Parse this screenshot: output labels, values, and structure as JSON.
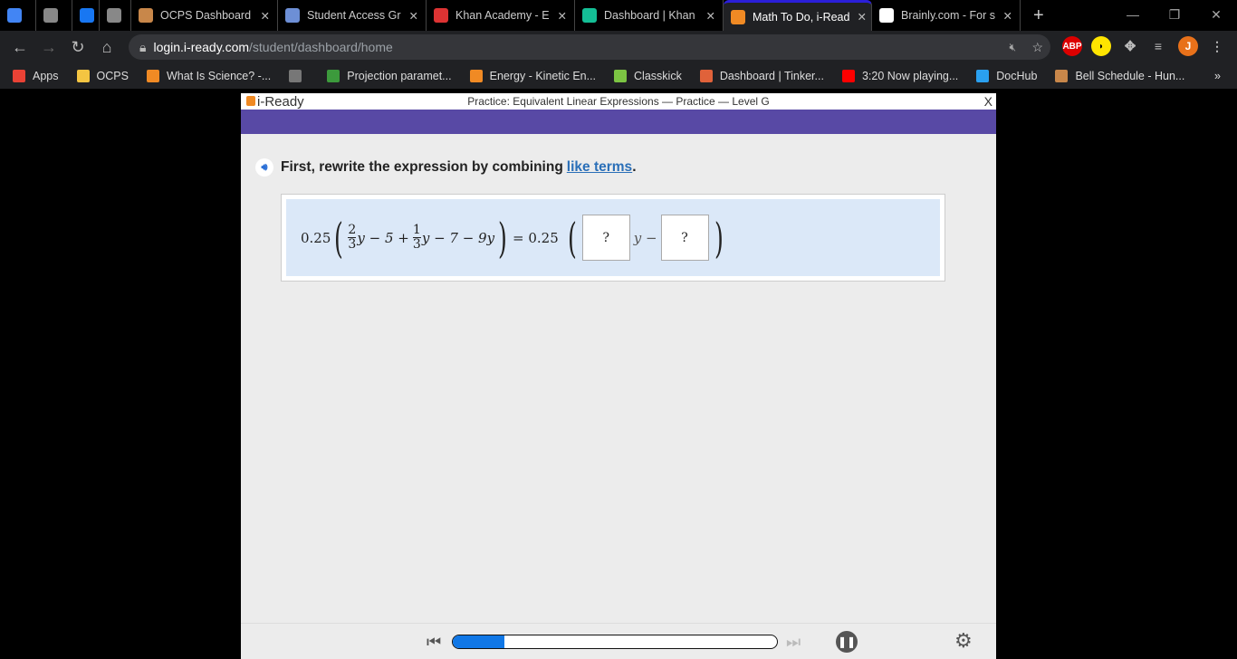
{
  "tabs": [
    {
      "label": "",
      "icon": "docs-icon",
      "color": "#4285f4"
    },
    {
      "label": "",
      "icon": "muted-audio-icon",
      "color": "#888"
    },
    {
      "label": "",
      "icon": "facebook-icon",
      "color": "#1877f2"
    },
    {
      "label": "",
      "icon": "muted-audio-icon",
      "color": "#888"
    },
    {
      "label": "OCPS Dashboard",
      "icon": "ocps-icon",
      "color": "#c8874a"
    },
    {
      "label": "Student Access Gr",
      "icon": "student-access-icon",
      "color": "#6d8fd6"
    },
    {
      "label": "Khan Academy - E",
      "icon": "khan-loading-icon",
      "color": "#d33"
    },
    {
      "label": "Dashboard | Khan",
      "icon": "khan-icon",
      "color": "#14bf96"
    },
    {
      "label": "Math To Do, i-Read",
      "icon": "iready-icon",
      "color": "#f08a24",
      "active": true
    },
    {
      "label": "Brainly.com - For s",
      "icon": "brainly-icon",
      "color": "#fff"
    }
  ],
  "url": {
    "domain": "login.i-ready.com",
    "path": "/student/dashboard/home"
  },
  "profile_initial": "J",
  "ext_abp": "ABP",
  "bookmarks": [
    {
      "label": "Apps",
      "color": "#e94235"
    },
    {
      "label": "OCPS",
      "color": "#f4c542"
    },
    {
      "label": "What Is Science? -...",
      "color": "#f08a24"
    },
    {
      "label": "",
      "color": "#777"
    },
    {
      "label": "Projection paramet...",
      "color": "#3c9a3c"
    },
    {
      "label": "Energy - Kinetic En...",
      "color": "#f08a24"
    },
    {
      "label": "Classkick",
      "color": "#7cc443"
    },
    {
      "label": "Dashboard | Tinker...",
      "color": "#e0623a"
    },
    {
      "label": "3:20 Now playing...",
      "color": "#f00"
    },
    {
      "label": "DocHub",
      "color": "#2aa0f0"
    },
    {
      "label": "Bell Schedule - Hun...",
      "color": "#c8874a"
    }
  ],
  "bookmarks_more": "»",
  "app": {
    "logo": "i-Ready",
    "title": "Practice: Equivalent Linear Expressions — Practice — Level G",
    "close": "X",
    "prompt": "First, rewrite the expression by combining",
    "prompt_link": "like terms",
    "prompt_end": ".",
    "equation": {
      "coef": "0.25",
      "f1_num": "2",
      "f1_den": "3",
      "t1": "y − 5 +",
      "f2_num": "1",
      "f2_den": "3",
      "t2": "y − 7 − 9y",
      "eq": "= 0.25",
      "box1": "?",
      "mid": "y −",
      "box2": "?"
    },
    "progress_percent": 16,
    "accent": "#5849a5"
  }
}
